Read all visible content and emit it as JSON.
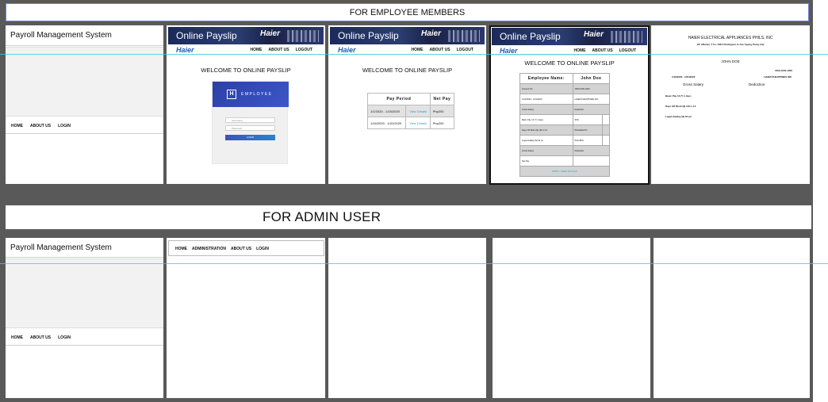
{
  "employee_section": {
    "banner": "FOR EMPLOYEE MEMBERS",
    "home": {
      "title": "Payroll Management System",
      "nav": [
        "HOME",
        "ABOUT US",
        "LOGIN"
      ]
    },
    "portal": {
      "header_title": "Online Payslip",
      "brand": "Haier",
      "nav_logo": "Haier",
      "nav_links": [
        "HOME",
        "ABOUT US",
        "LOGOUT"
      ],
      "welcome": "WELCOME TO ONLINE PAYSLIP"
    },
    "login": {
      "badge_letter": "H",
      "badge_label": "EMPLOYEE",
      "username_placeholder": "Username",
      "password_placeholder": "Password",
      "button": "LOGIN"
    },
    "pay_periods": {
      "headers": [
        "Pay Period",
        "Net Pay"
      ],
      "rows": [
        {
          "period": "1/1/2020 - 1/15/2020",
          "link": "View Details",
          "net": "Php200"
        },
        {
          "period": "1/16/2020 - 1/31/2020",
          "link": "View Details",
          "net": "Php200"
        }
      ]
    },
    "details": {
      "employee_label": "Employee Name:",
      "employee_name": "John Doe",
      "rows": [
        [
          "Account No.",
          "1000-1000-1000",
          ""
        ],
        [
          "1/16/2020 - 1/31/2020",
          "HAIER PHILIPPINES INC.",
          ""
        ],
        [
          "Gross Salary",
          "Deduction",
          ""
        ],
        [
          "Basic Pay 13 (*) 1 days",
          "SSS",
          ""
        ],
        [
          "Days Off Work ($) 140.1 4.2",
          "PHILHEALTH",
          ""
        ],
        [
          "Legal Holiday ($) 52 (x)",
          "PAG-IBIG",
          ""
        ],
        [
          "Gross Salary",
          "Deduction",
          ""
        ],
        [
          "Net Pay",
          "",
          ""
        ]
      ],
      "footer_link": "PRINT / VIEW PAYSLIP"
    },
    "print": {
      "company": "HAIER ELECTRICAL APPLIANCES PHILS. INC",
      "address": "4/F Villamor T Co. #98 A Rodriguez Jr Ave Ugong Pasig City",
      "employee": "JOHN DOE",
      "account": "1000-1000-1000",
      "period": "1/16/2020 - 1/31/2020",
      "company_short": "HAIER PHILIPPINES INC.",
      "gross_label": "Gross Salary",
      "deduction_label": "Deduction",
      "items": [
        "Basic Pay 13 (*) 1 days",
        "Days Off Work ($) 140.1 4.2",
        "Legal Holiday ($) 52 (x)"
      ]
    }
  },
  "admin_section": {
    "banner": "FOR ADMIN USER",
    "home": {
      "title": "Payroll Management System",
      "nav": [
        "HOME",
        "ABOUT US",
        "LOGIN"
      ]
    },
    "admin_nav": [
      "HOME",
      "ADMINISTRATION",
      "ABOUT US",
      "LOGIN"
    ]
  },
  "colors": {
    "canvas": "#595959",
    "guide": "#41c9d9",
    "header_navy": "#1b2a5a",
    "link": "#2a9fd0",
    "brand_blue": "#1c5fb5"
  }
}
